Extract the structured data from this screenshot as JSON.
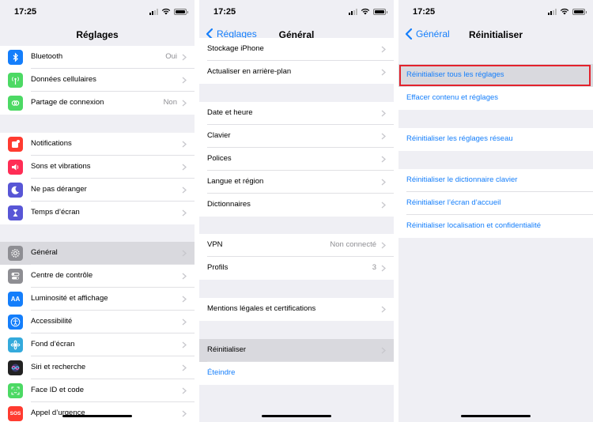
{
  "status": {
    "time": "17:25"
  },
  "left": {
    "title": "Réglages",
    "groups": [
      {
        "rows": [
          {
            "label": "Bluetooth",
            "value": "Oui",
            "icon": "bluetooth-icon",
            "color": "#147efb"
          },
          {
            "label": "Données cellulaires",
            "value": "",
            "icon": "antenna-icon",
            "color": "#4cd964"
          },
          {
            "label": "Partage de connexion",
            "value": "Non",
            "icon": "link-icon",
            "color": "#4cd964"
          }
        ]
      },
      {
        "rows": [
          {
            "label": "Notifications",
            "value": "",
            "icon": "notifications-icon",
            "color": "#ff3b30"
          },
          {
            "label": "Sons et vibrations",
            "value": "",
            "icon": "speaker-icon",
            "color": "#ff2d55"
          },
          {
            "label": "Ne pas déranger",
            "value": "",
            "icon": "moon-icon",
            "color": "#5856d6"
          },
          {
            "label": "Temps d’écran",
            "value": "",
            "icon": "hourglass-icon",
            "color": "#5856d6"
          }
        ]
      },
      {
        "rows": [
          {
            "label": "Général",
            "value": "",
            "icon": "gear-icon",
            "color": "#8e8e93",
            "selected": true
          },
          {
            "label": "Centre de contrôle",
            "value": "",
            "icon": "toggles-icon",
            "color": "#8e8e93"
          },
          {
            "label": "Luminosité et affichage",
            "value": "",
            "icon": "text-size-icon",
            "color": "#147efb",
            "icon_text": "AA"
          },
          {
            "label": "Accessibilité",
            "value": "",
            "icon": "accessibility-icon",
            "color": "#147efb"
          },
          {
            "label": "Fond d’écran",
            "value": "",
            "icon": "flower-icon",
            "color": "#34aadc"
          },
          {
            "label": "Siri et recherche",
            "value": "",
            "icon": "siri-icon",
            "color": "#222"
          },
          {
            "label": "Face ID et code",
            "value": "",
            "icon": "face-id-icon",
            "color": "#4cd964"
          },
          {
            "label": "Appel d’urgence",
            "value": "",
            "icon": "sos-icon",
            "color": "#ff3b30",
            "icon_text": "SOS"
          }
        ]
      }
    ]
  },
  "middle": {
    "back": "Réglages",
    "title": "Général",
    "groups": [
      {
        "rows": [
          {
            "label": "Stockage iPhone",
            "value": ""
          },
          {
            "label": "Actualiser en arrière-plan",
            "value": ""
          }
        ]
      },
      {
        "rows": [
          {
            "label": "Date et heure",
            "value": ""
          },
          {
            "label": "Clavier",
            "value": ""
          },
          {
            "label": "Polices",
            "value": ""
          },
          {
            "label": "Langue et région",
            "value": ""
          },
          {
            "label": "Dictionnaires",
            "value": ""
          }
        ]
      },
      {
        "rows": [
          {
            "label": "VPN",
            "value": "Non connecté"
          },
          {
            "label": "Profils",
            "value": "3"
          }
        ]
      },
      {
        "rows": [
          {
            "label": "Mentions légales et certifications",
            "value": ""
          }
        ]
      },
      {
        "rows": [
          {
            "label": "Réinitialiser",
            "value": "",
            "selected": true
          },
          {
            "label": "Éteindre",
            "value": "",
            "blue": true,
            "no_chevron": true
          }
        ]
      }
    ]
  },
  "right": {
    "back": "Général",
    "title": "Réinitialiser",
    "groups": [
      {
        "rows": [
          {
            "label": "Réinitialiser tous les réglages",
            "selected": true
          },
          {
            "label": "Effacer contenu et réglages"
          }
        ]
      },
      {
        "rows": [
          {
            "label": "Réinitialiser les réglages réseau"
          }
        ]
      },
      {
        "rows": [
          {
            "label": "Réinitialiser le dictionnaire clavier"
          },
          {
            "label": "Réinitialiser l’écran d’accueil"
          },
          {
            "label": "Réinitialiser localisation et confidentialité"
          }
        ]
      }
    ],
    "highlight_color": "#e3222c"
  }
}
